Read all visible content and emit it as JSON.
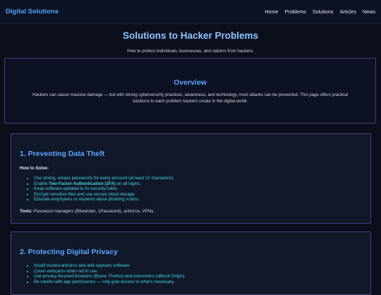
{
  "nav": {
    "brand": "Digital Solutions",
    "links": [
      "Home",
      "Problems",
      "Solutions",
      "Articles",
      "News"
    ]
  },
  "hero": {
    "title": "Solutions to Hacker Problems",
    "subtitle": "How to protect individuals, businesses, and nations from hackers."
  },
  "overview": {
    "heading": "Overview",
    "text": "Hackers can cause massive damage — but with strong cybersecurity practices, awareness, and technology, most attacks can be prevented. This page offers practical solutions to each problem hackers create in the digital world."
  },
  "sections": [
    {
      "heading": "1. Preventing Data Theft",
      "how_to": "How to Solve:",
      "items": [
        "Use strong, unique passwords for every account (at least 12 characters).",
        "Keep software updated to fix security holes.",
        "Encrypt sensitive files and use secure cloud storage.",
        "Educate employees or students about phishing scams."
      ],
      "twofa": {
        "prefix": "Enable ",
        "bold": "Two-Factor Authentication (2FA)",
        "suffix": " on all logins."
      },
      "tools_label": "Tools:",
      "tools_text": " Password managers (Bitwarden, 1Password), antivirus, VPNs."
    },
    {
      "heading": "2. Protecting Digital Privacy",
      "items": [
        "Install trusted antivirus and anti-spyware software.",
        "Cover webcams when not in use.",
        "Use privacy-focused browsers (Brave, Firefox) and extensions (uBlock Origin).",
        "Be careful with app permissions — only give access to what's necessary."
      ]
    }
  ]
}
